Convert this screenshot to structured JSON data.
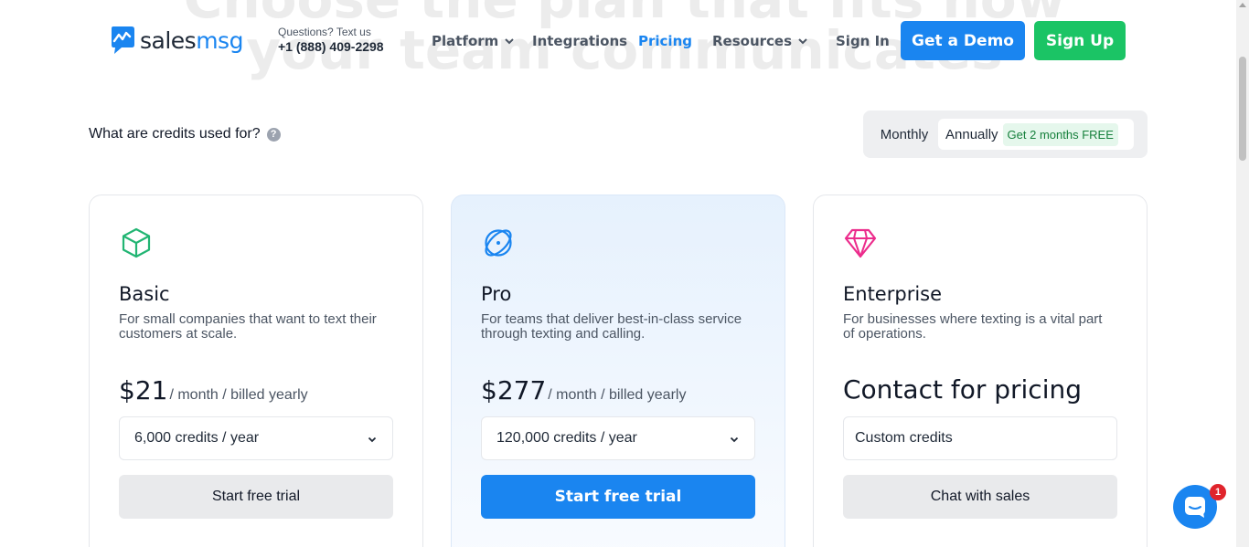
{
  "hero": {
    "line1": "Choose the plan that fits how",
    "line2": "your team communicates"
  },
  "header": {
    "logo_sales": "sales",
    "logo_msg": "msg",
    "contact_question": "Questions? Text us",
    "contact_phone": "+1 (888) 409-2298",
    "nav": [
      {
        "label": "Platform",
        "dropdown": true
      },
      {
        "label": "Integrations",
        "dropdown": false
      },
      {
        "label": "Pricing",
        "dropdown": false,
        "active": true
      },
      {
        "label": "Resources",
        "dropdown": true
      },
      {
        "label": "Sign In",
        "dropdown": false
      }
    ],
    "demo_label": "Get a Demo",
    "signup_label": "Sign Up"
  },
  "credits_question": "What are credits used for?",
  "help_icon_glyph": "?",
  "billing": {
    "monthly_label": "Monthly",
    "annual_label": "Annually",
    "annual_badge": "Get 2 months FREE",
    "selected": "Annually"
  },
  "plans": [
    {
      "icon": "cube-icon",
      "name": "Basic",
      "description": "For small companies that want to text their customers at scale.",
      "price": "$21",
      "price_period": "/ month / billed yearly",
      "credits": "6,000 credits / year",
      "cta": "Start free trial"
    },
    {
      "icon": "atom-icon",
      "name": "Pro",
      "description": "For teams that deliver best-in-class service through texting and calling.",
      "price": "$277",
      "price_period": "/ month / billed yearly",
      "credits": "120,000 credits / year",
      "cta": "Start free trial"
    },
    {
      "icon": "diamond-icon",
      "name": "Enterprise",
      "description": "For businesses where texting is a vital part of operations.",
      "price_text": "Contact for pricing",
      "credits": "Custom credits",
      "cta": "Chat with sales"
    }
  ],
  "chat": {
    "badge_count": "1"
  },
  "colors": {
    "brand_blue": "#1a85f0",
    "signup_green": "#1bc465",
    "basic_icon": "#22b573",
    "pro_icon": "#1a85f0",
    "enterprise_icon": "#ec2c8c"
  }
}
